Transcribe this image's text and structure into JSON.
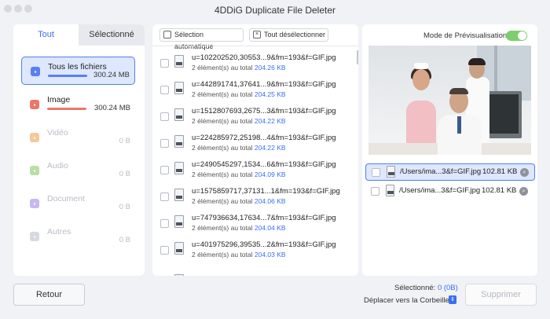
{
  "window": {
    "title": "4DDiG Duplicate File Deleter"
  },
  "left": {
    "tabs": [
      {
        "label": "Tout"
      },
      {
        "label": "Sélectionné"
      }
    ],
    "categories": [
      {
        "label": "Tous les fichiers",
        "size": "300.24 MB",
        "icon": "folder-icon",
        "color": "#5b7ff0",
        "fill": 1.0
      },
      {
        "label": "Image",
        "size": "300.24 MB",
        "icon": "image-icon",
        "color": "#e9776a",
        "fill": 1.0
      },
      {
        "label": "Vidéo",
        "size": "0 B",
        "icon": "video-icon",
        "color": "#f5c89a"
      },
      {
        "label": "Audio",
        "size": "0 B",
        "icon": "audio-icon",
        "color": "#b8dfa6"
      },
      {
        "label": "Document",
        "size": "0 B",
        "icon": "document-icon",
        "color": "#c7b8f2"
      },
      {
        "label": "Autres",
        "size": "0 B",
        "icon": "other-icon",
        "color": "#d6d9df"
      }
    ]
  },
  "middle": {
    "auto_select_label": "Sélection automatique",
    "deselect_all_label": "Tout désélectionner",
    "files": [
      {
        "name": "u=102202520,30553...9&fm=193&f=GIF.jpg",
        "count": "2 élément(s) au total",
        "size": "204.26 KB"
      },
      {
        "name": "u=442891741,37641...9&fm=193&f=GIF.jpg",
        "count": "2 élément(s) au total",
        "size": "204.25 KB"
      },
      {
        "name": "u=1512807693,2675...3&fm=193&f=GIF.jpg",
        "count": "2 élément(s) au total",
        "size": "204.22 KB"
      },
      {
        "name": "u=224285972,25198...4&fm=193&f=GIF.jpg",
        "count": "2 élément(s) au total",
        "size": "204.22 KB"
      },
      {
        "name": "u=2490545297,1534...6&fm=193&f=GIF.jpg",
        "count": "2 élément(s) au total",
        "size": "204.09 KB"
      },
      {
        "name": "u=1575859717,37131...1&fm=193&f=GIF.jpg",
        "count": "2 élément(s) au total",
        "size": "204.06 KB"
      },
      {
        "name": "u=747936634,17634...7&fm=193&f=GIF.jpg",
        "count": "2 élément(s) au total",
        "size": "204.04 KB"
      },
      {
        "name": "u=401975296,39535...2&fm=193&f=GIF.jpg",
        "count": "2 élément(s) au total",
        "size": "204.03 KB"
      }
    ]
  },
  "right": {
    "preview_mode_label": "Mode de Prévisualisation",
    "preview_enabled": true,
    "paths": [
      {
        "name": "/Users/ima...3&f=GIF.jpg",
        "size": "102.81 KB"
      },
      {
        "name": "/Users/ima...3&f=GIF.jpg",
        "size": "102.81 KB"
      }
    ]
  },
  "bottom": {
    "back_label": "Retour",
    "selected_label": "Sélectionné:",
    "selected_value": "0 (0B)",
    "move_label": "Déplacer vers la Corbeille",
    "delete_label": "Supprimer"
  }
}
